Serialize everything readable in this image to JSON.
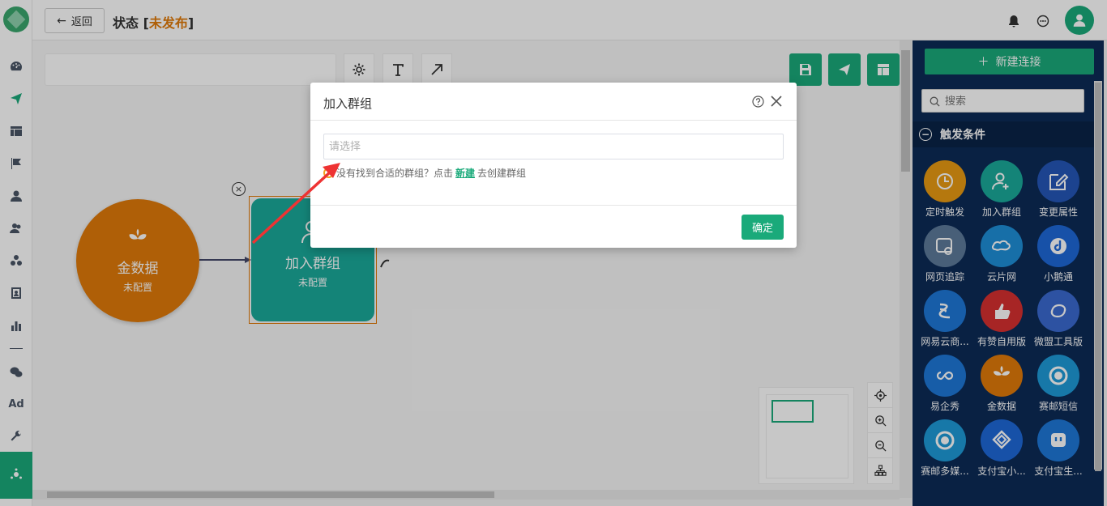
{
  "header": {
    "back_label": "返回",
    "title": "状态",
    "status_open": "[",
    "status": "未发布",
    "status_close": "]"
  },
  "canvas": {
    "nodes": [
      {
        "title": "金数据",
        "subtitle": "未配置",
        "color": "#e07a0a",
        "icon": "sprout-icon"
      },
      {
        "title": "加入群组",
        "subtitle": "未配置",
        "color": "#1aaa9a",
        "icon": "user-add-icon"
      }
    ]
  },
  "right_panel": {
    "new_connection_label": "新建连接",
    "search_placeholder": "搜索",
    "section_title": "触发条件",
    "items": [
      {
        "label": "定时触发",
        "color": "#e89a12",
        "icon": "clock-icon"
      },
      {
        "label": "加入群组",
        "color": "#1aaa9a",
        "icon": "user-add-icon"
      },
      {
        "label": "变更属性",
        "color": "#2456b8",
        "icon": "edit-icon"
      },
      {
        "label": "网页追踪",
        "color": "#5d7a9a",
        "icon": "web-track-icon"
      },
      {
        "label": "云片网",
        "color": "#1e8fd8",
        "icon": "cloud-icon"
      },
      {
        "label": "小鹅通",
        "color": "#1e68d8",
        "icon": "note-icon"
      },
      {
        "label": "网易云商...",
        "color": "#1e78d8",
        "icon": "netease-icon"
      },
      {
        "label": "有赞自用版",
        "color": "#d63030",
        "icon": "thumb-icon"
      },
      {
        "label": "微盟工具版",
        "color": "#3a6ad0",
        "icon": "weimob-icon"
      },
      {
        "label": "易企秀",
        "color": "#1e78d8",
        "icon": "infinity-icon"
      },
      {
        "label": "金数据",
        "color": "#e07a0a",
        "icon": "sprout-icon"
      },
      {
        "label": "赛邮短信",
        "color": "#1e9ad8",
        "icon": "submail-icon"
      },
      {
        "label": "赛邮多媒...",
        "color": "#1e9ad8",
        "icon": "submail-icon"
      },
      {
        "label": "支付宝小...",
        "color": "#1e68d8",
        "icon": "alipay-mini-icon"
      },
      {
        "label": "支付宝生...",
        "color": "#1e78d8",
        "icon": "alipay-life-icon"
      }
    ]
  },
  "modal": {
    "title": "加入群组",
    "select_placeholder": "请选择",
    "hint_prefix": "没有找到合适的群组？点击",
    "hint_link": "新建",
    "hint_suffix": "去创建群组",
    "ok_label": "确定"
  }
}
